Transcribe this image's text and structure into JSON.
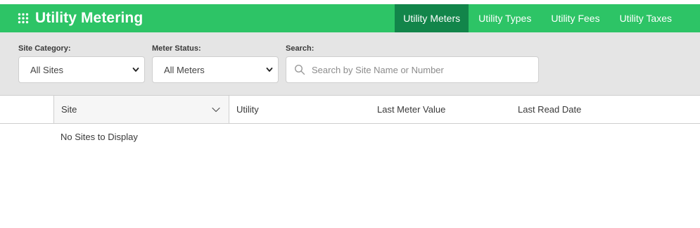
{
  "header": {
    "title": "Utility Metering",
    "app_icon": "grid-dots-icon",
    "brand_color": "#2dc466",
    "active_tab_color": "#12854a",
    "tabs": [
      {
        "label": "Utility Meters",
        "active": true
      },
      {
        "label": "Utility Types",
        "active": false
      },
      {
        "label": "Utility Fees",
        "active": false
      },
      {
        "label": "Utility Taxes",
        "active": false
      }
    ]
  },
  "filters": {
    "site_category": {
      "label": "Site Category:",
      "value": "All Sites"
    },
    "meter_status": {
      "label": "Meter Status:",
      "value": "All Meters"
    },
    "search": {
      "label": "Search:",
      "placeholder": "Search by Site Name or Number",
      "value": ""
    }
  },
  "table": {
    "columns": [
      "",
      "Site",
      "Utility",
      "Last Meter Value",
      "Last Read Date"
    ],
    "sorted_column": "Site",
    "rows": [],
    "empty_message": "No Sites to Display"
  }
}
